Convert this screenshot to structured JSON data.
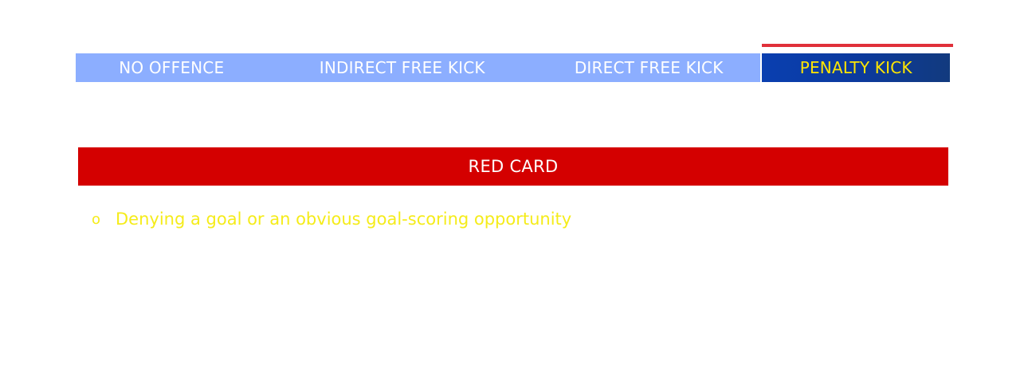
{
  "tabs": [
    {
      "label": "NO OFFENCE",
      "active": false
    },
    {
      "label": "INDIRECT FREE KICK",
      "active": false
    },
    {
      "label": "DIRECT FREE KICK",
      "active": false
    },
    {
      "label": "PENALTY KICK",
      "active": true
    }
  ],
  "colors": {
    "tab_inactive_bg": "#8caeff",
    "tab_active_bg": "#0b3a9e",
    "tab_active_text": "#ffe600",
    "active_indicator": "#e0303a",
    "red_card_bg": "#d40000",
    "item_text": "#f5ec1a"
  },
  "section": {
    "title": "RED CARD"
  },
  "items": [
    {
      "bullet": "o",
      "text": "Denying a goal or an obvious goal-scoring opportunity"
    }
  ]
}
